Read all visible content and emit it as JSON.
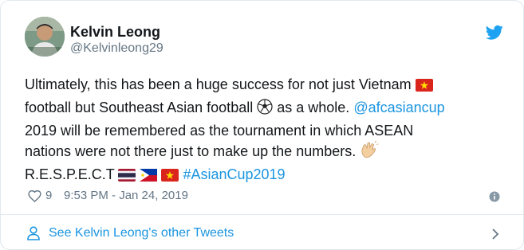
{
  "tweet": {
    "author": {
      "name": "Kelvin Leong",
      "handle": "@Kelvinleong29"
    },
    "text": {
      "line1": "Ultimately, this has been a huge success for not just Vietnam",
      "line2a": "football but Southeast Asian football",
      "line2b": "as a whole.",
      "mention": "@afcasiancup",
      "line3": "2019 will be remembered as the tournament in which ASEAN",
      "line4": "nations were not there just to make up the numbers.",
      "line5": "R.E.S.P.E.C.T",
      "hashtag": "#AsianCup2019"
    },
    "likes": "9",
    "timestamp": "9:53 PM - Jan 24, 2019"
  },
  "footer": {
    "label": "See Kelvin Leong's other Tweets"
  },
  "icons": [
    "twitter-bird-icon",
    "vietnam-flag-icon",
    "soccer-ball-icon",
    "clapping-hands-icon",
    "thailand-flag-icon",
    "philippines-flag-icon",
    "heart-icon",
    "info-icon",
    "person-icon",
    "chevron-right-icon"
  ],
  "colors": {
    "link": "#1b95e0",
    "secondary": "#657786",
    "text": "#14171a",
    "border": "#e1e8ed"
  }
}
